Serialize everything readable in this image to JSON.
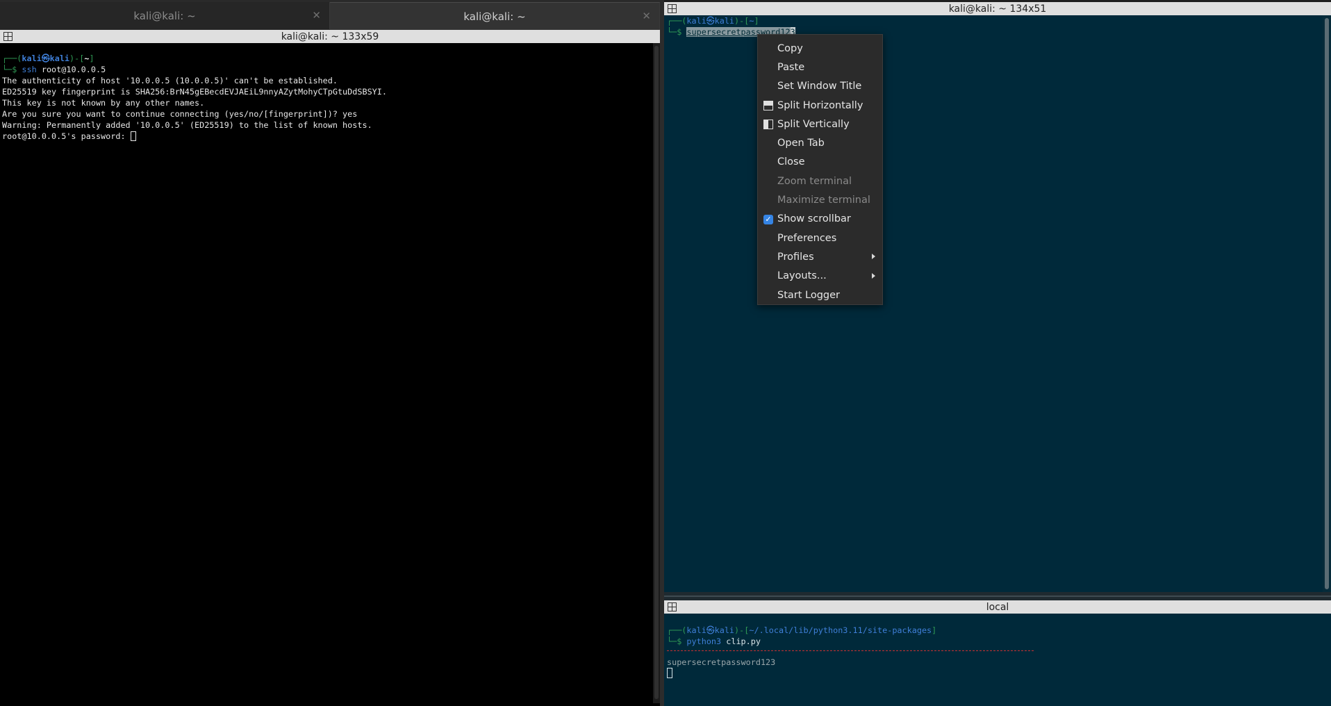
{
  "left_window": {
    "tabs": [
      {
        "label": "kali@kali: ~",
        "active": false
      },
      {
        "label": "kali@kali: ~",
        "active": true
      }
    ],
    "title": "kali@kali: ~ 133x59",
    "lines": {
      "prompt_top": "┌──(",
      "prompt_user": "kali㉿kali",
      "prompt_mid": ")-[",
      "prompt_dir": "~",
      "prompt_end": "]",
      "prompt_bottom": "└─$ ",
      "cmd_name": "ssh",
      "cmd_args": " root@10.0.0.5",
      "out1": "The authenticity of host '10.0.0.5 (10.0.0.5)' can't be established.",
      "out2": "ED25519 key fingerprint is SHA256:BrN45gEBecdEVJAEiL9nnyAZytMohyCTpGtuDdSBSYI.",
      "out3": "This key is not known by any other names.",
      "out4": "Are you sure you want to continue connecting (yes/no/[fingerprint])? yes",
      "out5": "Warning: Permanently added '10.0.0.5' (ED25519) to the list of known hosts.",
      "out6": "root@10.0.0.5's password: "
    }
  },
  "right_top": {
    "title": "kali@kali: ~ 134x51",
    "prompt_top": "┌──(",
    "prompt_user": "kali㉿kali",
    "prompt_mid": ")-[",
    "prompt_dir": "~",
    "prompt_end": "]",
    "prompt_bottom": "└─$ ",
    "selected_text": "supersecretpassword12",
    "selected_tail": "3"
  },
  "right_bottom": {
    "title": "local",
    "prompt_top": "┌──(",
    "prompt_user": "kali㉿kali",
    "prompt_mid": ")-[",
    "prompt_dir": "~/.local/lib/python3.11/site-packages",
    "prompt_end": "]",
    "prompt_bottom": "└─$ ",
    "cmd_name": "python3",
    "cmd_args": " clip.py",
    "output": "supersecretpassword123"
  },
  "context_menu": {
    "items": [
      {
        "label": "Copy",
        "enabled": true
      },
      {
        "label": "Paste",
        "enabled": true
      },
      {
        "label": "Set Window Title",
        "enabled": true
      },
      {
        "label": "Split Horizontally",
        "enabled": true,
        "icon": "split-horizontal-icon"
      },
      {
        "label": "Split Vertically",
        "enabled": true,
        "icon": "split-vertical-icon"
      },
      {
        "label": "Open Tab",
        "enabled": true
      },
      {
        "label": "Close",
        "enabled": true
      },
      {
        "label": "Zoom terminal",
        "enabled": false
      },
      {
        "label": "Maximize terminal",
        "enabled": false
      },
      {
        "label": "Show scrollbar",
        "enabled": true,
        "checked": true
      },
      {
        "label": "Preferences",
        "enabled": true
      },
      {
        "label": "Profiles",
        "enabled": true,
        "submenu": true
      },
      {
        "label": "Layouts...",
        "enabled": true,
        "submenu": true
      },
      {
        "label": "Start Logger",
        "enabled": true
      }
    ]
  },
  "colors": {
    "terminal_bg_dark": "#000000",
    "terminal_bg_solarized": "#00293a",
    "prompt_green": "#2f9a55",
    "prompt_blue": "#3f7fd8",
    "menu_bg": "#2b2b2b",
    "checkbox_accent": "#3584e4"
  }
}
